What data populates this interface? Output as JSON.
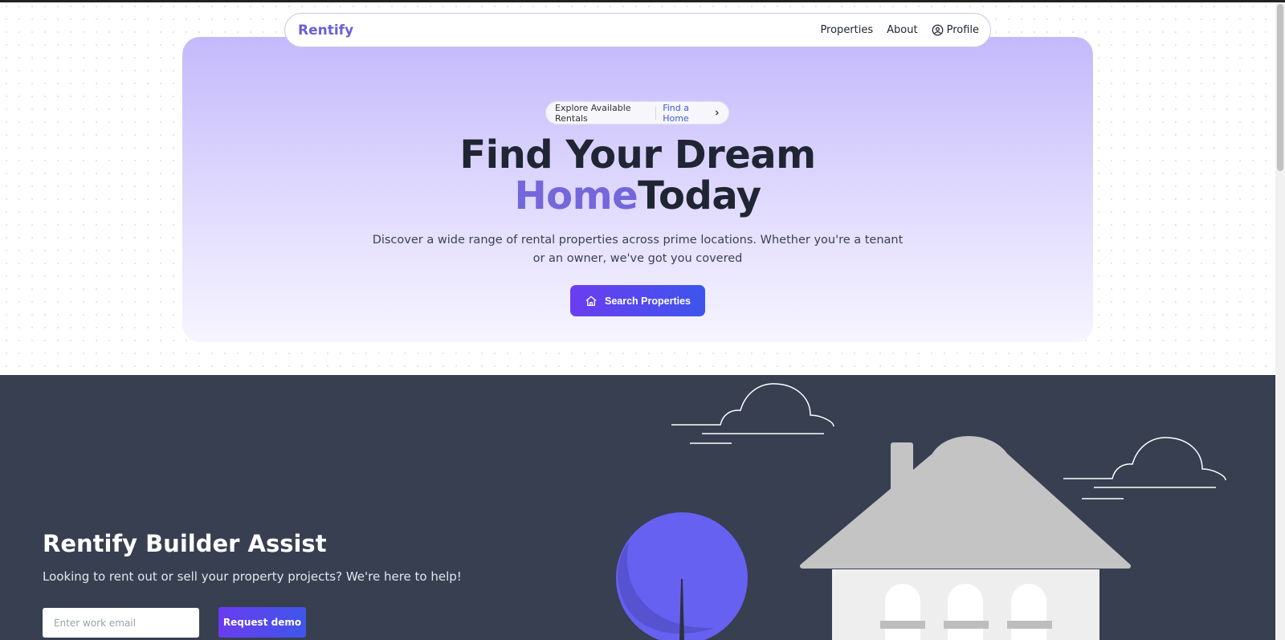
{
  "nav": {
    "brand": "Rentify",
    "links": [
      {
        "label": "Properties"
      },
      {
        "label": "About"
      },
      {
        "label": "Profile",
        "icon": "user-circle-icon"
      }
    ]
  },
  "hero": {
    "pill_text": "Explore Available Rentals",
    "pill_link": "Find a Home",
    "headline_line1": "Find Your Dream",
    "headline_accent": "Home",
    "headline_rest": "Today",
    "subtext": "Discover a wide range of rental properties across prime locations. Whether you're a tenant or an owner, we've got you covered",
    "cta_label": "Search Properties",
    "cta_icon": "home-icon"
  },
  "builder": {
    "title": "Rentify Builder Assist",
    "subtitle": "Looking to rent out or sell your property projects? We're here to help!",
    "email_placeholder": "Enter work email",
    "button_label": "Request demo"
  },
  "colors": {
    "brand": "#6b5fd8",
    "accent_text": "#7466db",
    "button_gradient_start": "#6b3df0",
    "button_gradient_end": "#3e55ec",
    "dark_section": "#373f51",
    "tree": "#6761f2",
    "house_roof": "#c4c4c4"
  }
}
